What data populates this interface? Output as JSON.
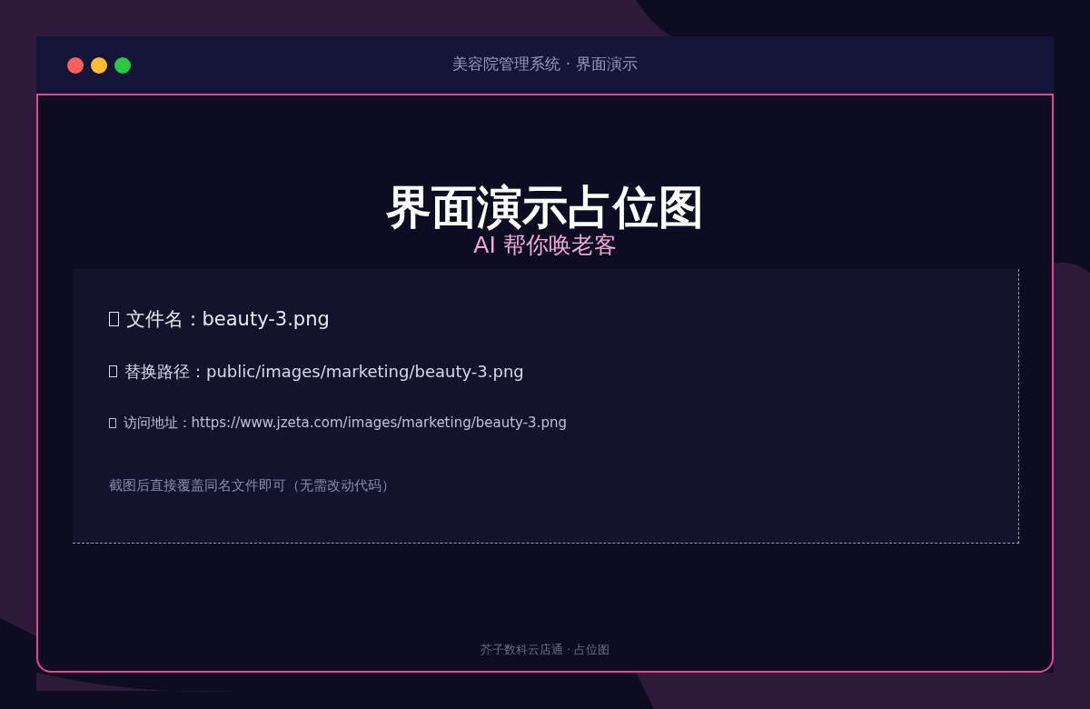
{
  "window": {
    "title": "美容院管理系统 · 界面演示"
  },
  "heading": "界面演示占位图",
  "subtitle": "AI 帮你唤老客",
  "info": {
    "lines": [
      {
        "kind": "large",
        "text": "文件名：beauty-3.png"
      },
      {
        "kind": "medium",
        "text": "替换路径：public/images/marketing/beauty-3.png"
      },
      {
        "kind": "small",
        "text": "访问地址：https://www.jzeta.com/images/marketing/beauty-3.png"
      }
    ],
    "note": "截图后直接覆盖同名文件即可（无需改动代码）"
  },
  "footer": "芥子数科云店通 · 占位图"
}
